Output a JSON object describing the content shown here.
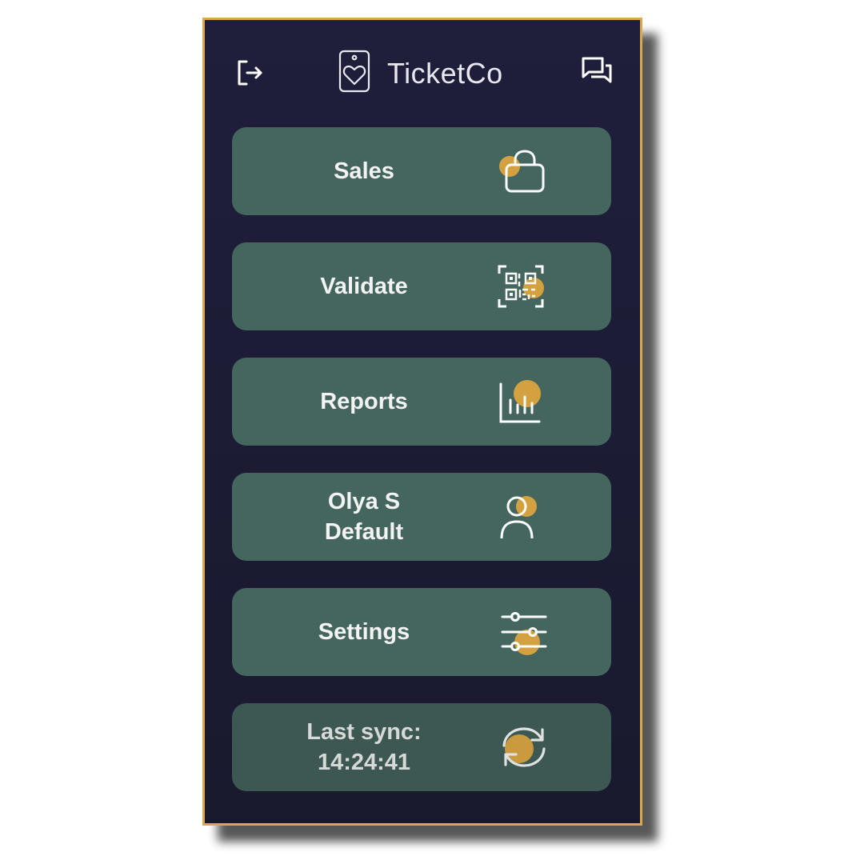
{
  "app": {
    "name": "TicketCo"
  },
  "header": {
    "logout_icon": "logout-icon",
    "logo_icon": "ticket-heart-logo-icon",
    "chat_icon": "chat-icon"
  },
  "menu": [
    {
      "id": "sales",
      "label": "Sales",
      "icon": "shopping-bag-icon"
    },
    {
      "id": "validate",
      "label": "Validate",
      "icon": "qr-scan-icon"
    },
    {
      "id": "reports",
      "label": "Reports",
      "icon": "bar-chart-icon"
    },
    {
      "id": "profile",
      "label_line1": "Olya S",
      "label_line2": "Default",
      "icon": "user-icon"
    },
    {
      "id": "settings",
      "label": "Settings",
      "icon": "sliders-icon"
    },
    {
      "id": "sync",
      "label_line1": "Last sync:",
      "label_line2": "14:24:41",
      "icon": "sync-icon"
    }
  ],
  "colors": {
    "background": "#1f1f3c",
    "button": "#44665f",
    "accent_dot": "#d4a140",
    "frame_border": "#d9a94a",
    "text": "#f3f3f3"
  }
}
